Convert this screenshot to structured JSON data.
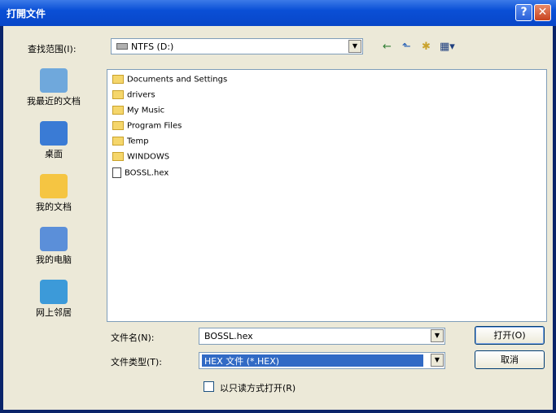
{
  "window": {
    "title": "打開文件",
    "help_label": "?",
    "close_label": "✕"
  },
  "lookin": {
    "label": "查找范围(I):",
    "value": "NTFS (D:)",
    "drive_icon": "drive-icon",
    "arrow": "▼"
  },
  "toolbar": {
    "back_icon": "←",
    "up_icon": "⬑",
    "new_folder_icon": "✱",
    "views_icon": "▦▾"
  },
  "places": [
    {
      "label": "我最近的文档",
      "icon": "recent-documents-icon",
      "color": "#6fa8dc"
    },
    {
      "label": "桌面",
      "icon": "desktop-icon",
      "color": "#3a7bd5"
    },
    {
      "label": "我的文档",
      "icon": "my-documents-icon",
      "color": "#f5c542"
    },
    {
      "label": "我的电脑",
      "icon": "my-computer-icon",
      "color": "#5b8fd9"
    },
    {
      "label": "网上邻居",
      "icon": "network-places-icon",
      "color": "#3c9ad9"
    }
  ],
  "files": [
    {
      "name": "Documents and Settings",
      "type": "folder"
    },
    {
      "name": "drivers",
      "type": "folder"
    },
    {
      "name": "My Music",
      "type": "folder"
    },
    {
      "name": "Program Files",
      "type": "folder"
    },
    {
      "name": "Temp",
      "type": "folder"
    },
    {
      "name": "WINDOWS",
      "type": "folder"
    },
    {
      "name": "BOSSL.hex",
      "type": "file"
    }
  ],
  "filename": {
    "label": "文件名(N):",
    "value": "BOSSL.hex"
  },
  "filetype": {
    "label": "文件类型(T):",
    "value": "HEX 文件 (*.HEX)"
  },
  "readonly": {
    "label": "以只读方式打开(R)",
    "checked": false
  },
  "buttons": {
    "open": "打开(O)",
    "cancel": "取消"
  },
  "colors": {
    "titlebar": "#0a4fd6",
    "selection": "#316ac5",
    "face": "#ece9d8"
  }
}
